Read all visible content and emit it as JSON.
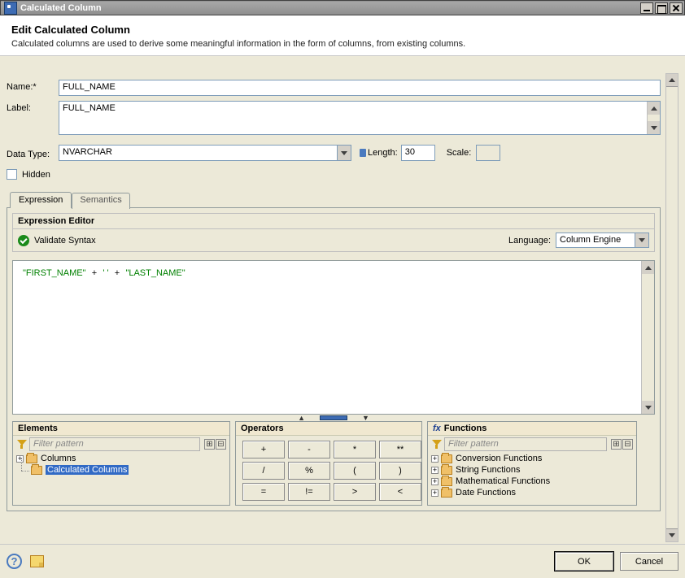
{
  "window": {
    "title": "Calculated Column"
  },
  "header": {
    "title": "Edit Calculated Column",
    "subtitle": "Calculated columns are used to derive some meaningful information in the form of columns, from existing columns."
  },
  "form": {
    "name_label": "Name:*",
    "name_value": "FULL_NAME",
    "label_label": "Label:",
    "label_value": "FULL_NAME",
    "datatype_label": "Data Type:",
    "datatype_value": "NVARCHAR",
    "length_label": "Length:",
    "length_value": "30",
    "scale_label": "Scale:",
    "scale_value": "",
    "hidden_label": "Hidden"
  },
  "tabs": {
    "expression": "Expression",
    "semantics": "Semantics"
  },
  "expression": {
    "header": "Expression Editor",
    "validate": "Validate Syntax",
    "language_label": "Language:",
    "language_value": "Column Engine",
    "code": {
      "p1": "\"FIRST_NAME\"",
      "p2": "+",
      "p3": "' '",
      "p4": "+",
      "p5": "\"LAST_NAME\""
    }
  },
  "elements": {
    "title": "Elements",
    "filter_placeholder": "Filter pattern",
    "tree": {
      "columns": "Columns",
      "calc": "Calculated Columns"
    }
  },
  "operators": {
    "title": "Operators",
    "items": [
      "+",
      "-",
      "*",
      "**",
      "/",
      "%",
      "(",
      ")",
      "=",
      "!=",
      ">",
      "<"
    ]
  },
  "functions": {
    "title": "Functions",
    "filter_placeholder": "Filter pattern",
    "tree": [
      "Conversion Functions",
      "String Functions",
      "Mathematical Functions",
      "Date Functions"
    ]
  },
  "footer": {
    "ok": "OK",
    "cancel": "Cancel"
  }
}
